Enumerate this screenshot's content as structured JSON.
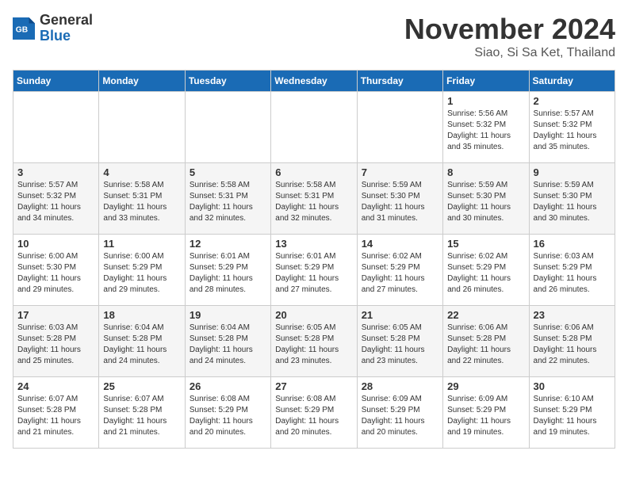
{
  "header": {
    "logo_general": "General",
    "logo_blue": "Blue",
    "month_title": "November 2024",
    "location": "Siao, Si Sa Ket, Thailand"
  },
  "days_of_week": [
    "Sunday",
    "Monday",
    "Tuesday",
    "Wednesday",
    "Thursday",
    "Friday",
    "Saturday"
  ],
  "weeks": [
    [
      {
        "day": "",
        "info": ""
      },
      {
        "day": "",
        "info": ""
      },
      {
        "day": "",
        "info": ""
      },
      {
        "day": "",
        "info": ""
      },
      {
        "day": "",
        "info": ""
      },
      {
        "day": "1",
        "info": "Sunrise: 5:56 AM\nSunset: 5:32 PM\nDaylight: 11 hours and 35 minutes."
      },
      {
        "day": "2",
        "info": "Sunrise: 5:57 AM\nSunset: 5:32 PM\nDaylight: 11 hours and 35 minutes."
      }
    ],
    [
      {
        "day": "3",
        "info": "Sunrise: 5:57 AM\nSunset: 5:32 PM\nDaylight: 11 hours and 34 minutes."
      },
      {
        "day": "4",
        "info": "Sunrise: 5:58 AM\nSunset: 5:31 PM\nDaylight: 11 hours and 33 minutes."
      },
      {
        "day": "5",
        "info": "Sunrise: 5:58 AM\nSunset: 5:31 PM\nDaylight: 11 hours and 32 minutes."
      },
      {
        "day": "6",
        "info": "Sunrise: 5:58 AM\nSunset: 5:31 PM\nDaylight: 11 hours and 32 minutes."
      },
      {
        "day": "7",
        "info": "Sunrise: 5:59 AM\nSunset: 5:30 PM\nDaylight: 11 hours and 31 minutes."
      },
      {
        "day": "8",
        "info": "Sunrise: 5:59 AM\nSunset: 5:30 PM\nDaylight: 11 hours and 30 minutes."
      },
      {
        "day": "9",
        "info": "Sunrise: 5:59 AM\nSunset: 5:30 PM\nDaylight: 11 hours and 30 minutes."
      }
    ],
    [
      {
        "day": "10",
        "info": "Sunrise: 6:00 AM\nSunset: 5:30 PM\nDaylight: 11 hours and 29 minutes."
      },
      {
        "day": "11",
        "info": "Sunrise: 6:00 AM\nSunset: 5:29 PM\nDaylight: 11 hours and 29 minutes."
      },
      {
        "day": "12",
        "info": "Sunrise: 6:01 AM\nSunset: 5:29 PM\nDaylight: 11 hours and 28 minutes."
      },
      {
        "day": "13",
        "info": "Sunrise: 6:01 AM\nSunset: 5:29 PM\nDaylight: 11 hours and 27 minutes."
      },
      {
        "day": "14",
        "info": "Sunrise: 6:02 AM\nSunset: 5:29 PM\nDaylight: 11 hours and 27 minutes."
      },
      {
        "day": "15",
        "info": "Sunrise: 6:02 AM\nSunset: 5:29 PM\nDaylight: 11 hours and 26 minutes."
      },
      {
        "day": "16",
        "info": "Sunrise: 6:03 AM\nSunset: 5:29 PM\nDaylight: 11 hours and 26 minutes."
      }
    ],
    [
      {
        "day": "17",
        "info": "Sunrise: 6:03 AM\nSunset: 5:28 PM\nDaylight: 11 hours and 25 minutes."
      },
      {
        "day": "18",
        "info": "Sunrise: 6:04 AM\nSunset: 5:28 PM\nDaylight: 11 hours and 24 minutes."
      },
      {
        "day": "19",
        "info": "Sunrise: 6:04 AM\nSunset: 5:28 PM\nDaylight: 11 hours and 24 minutes."
      },
      {
        "day": "20",
        "info": "Sunrise: 6:05 AM\nSunset: 5:28 PM\nDaylight: 11 hours and 23 minutes."
      },
      {
        "day": "21",
        "info": "Sunrise: 6:05 AM\nSunset: 5:28 PM\nDaylight: 11 hours and 23 minutes."
      },
      {
        "day": "22",
        "info": "Sunrise: 6:06 AM\nSunset: 5:28 PM\nDaylight: 11 hours and 22 minutes."
      },
      {
        "day": "23",
        "info": "Sunrise: 6:06 AM\nSunset: 5:28 PM\nDaylight: 11 hours and 22 minutes."
      }
    ],
    [
      {
        "day": "24",
        "info": "Sunrise: 6:07 AM\nSunset: 5:28 PM\nDaylight: 11 hours and 21 minutes."
      },
      {
        "day": "25",
        "info": "Sunrise: 6:07 AM\nSunset: 5:28 PM\nDaylight: 11 hours and 21 minutes."
      },
      {
        "day": "26",
        "info": "Sunrise: 6:08 AM\nSunset: 5:29 PM\nDaylight: 11 hours and 20 minutes."
      },
      {
        "day": "27",
        "info": "Sunrise: 6:08 AM\nSunset: 5:29 PM\nDaylight: 11 hours and 20 minutes."
      },
      {
        "day": "28",
        "info": "Sunrise: 6:09 AM\nSunset: 5:29 PM\nDaylight: 11 hours and 20 minutes."
      },
      {
        "day": "29",
        "info": "Sunrise: 6:09 AM\nSunset: 5:29 PM\nDaylight: 11 hours and 19 minutes."
      },
      {
        "day": "30",
        "info": "Sunrise: 6:10 AM\nSunset: 5:29 PM\nDaylight: 11 hours and 19 minutes."
      }
    ]
  ]
}
